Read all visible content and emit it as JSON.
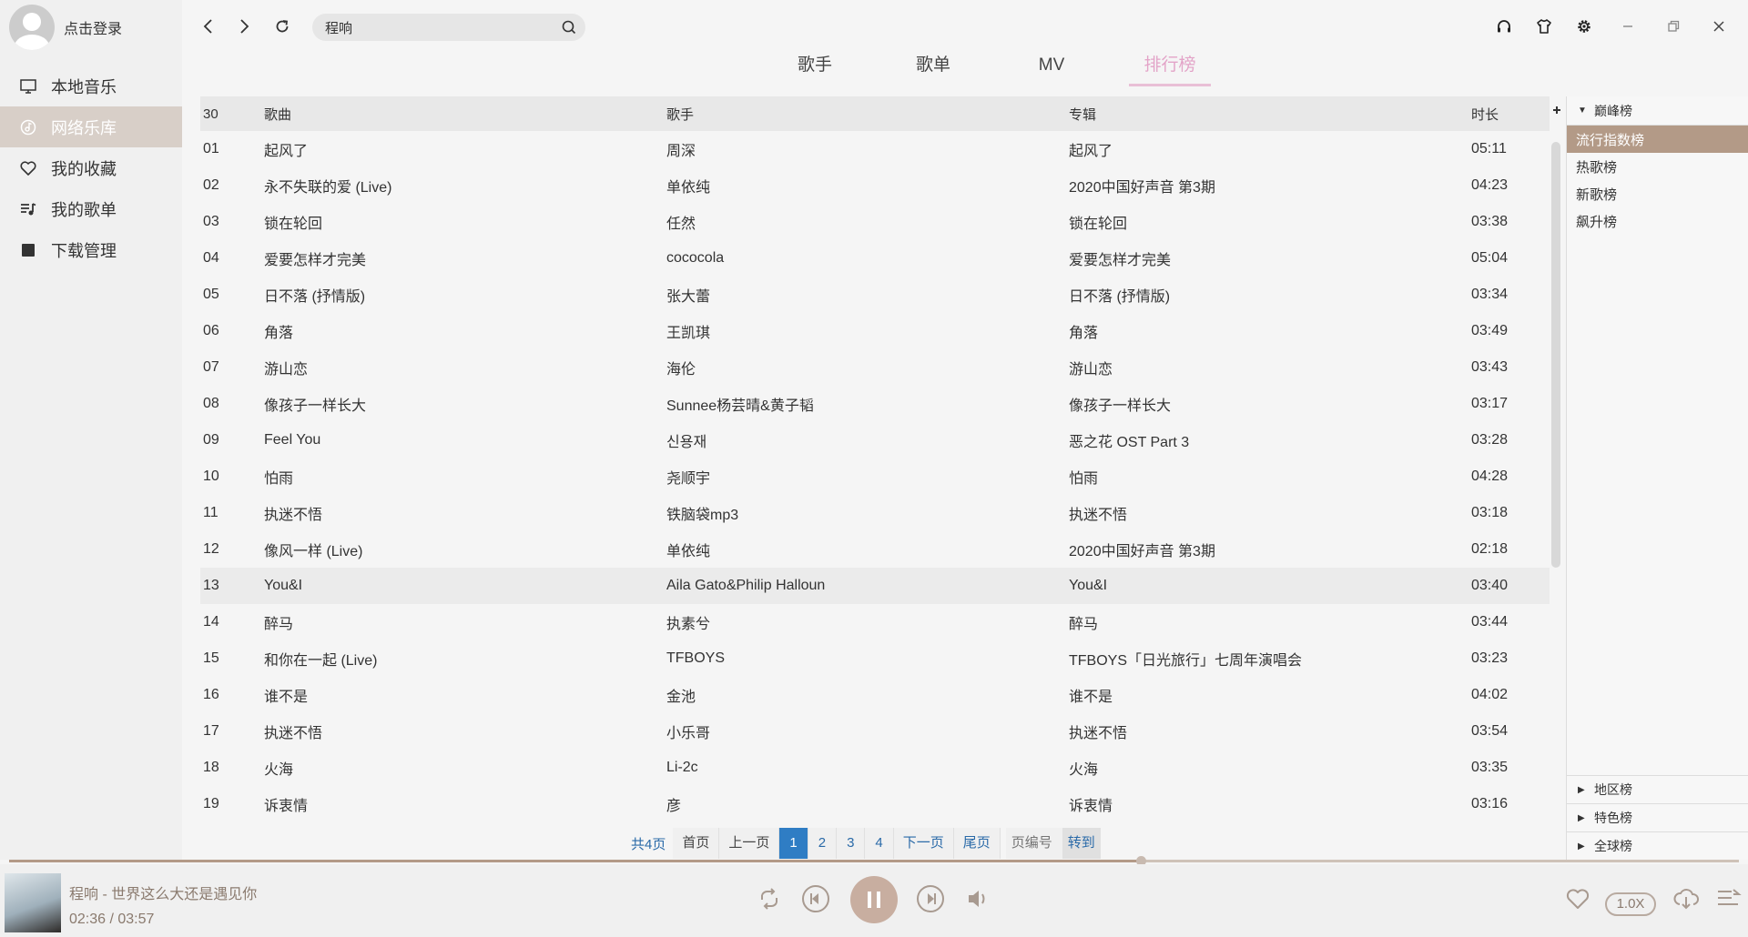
{
  "user": {
    "login_text": "点击登录"
  },
  "sidebar": {
    "items": [
      {
        "label": "本地音乐",
        "icon": "monitor-icon"
      },
      {
        "label": "网络乐库",
        "icon": "music-disc-icon"
      },
      {
        "label": "我的收藏",
        "icon": "heart-icon"
      },
      {
        "label": "我的歌单",
        "icon": "playlist-icon"
      },
      {
        "label": "下载管理",
        "icon": "download-box-icon"
      }
    ],
    "active_index": 1
  },
  "search": {
    "value": "程响"
  },
  "tabs": [
    "歌手",
    "歌单",
    "MV",
    "排行榜"
  ],
  "active_tab": 3,
  "table": {
    "header": {
      "count": "30",
      "song": "歌曲",
      "singer": "歌手",
      "album": "专辑",
      "duration": "时长"
    },
    "rows": [
      {
        "no": "01",
        "song": "起风了",
        "singer": "周深",
        "album": "起风了",
        "duration": "05:11"
      },
      {
        "no": "02",
        "song": "永不失联的爱 (Live)",
        "singer": "单依纯",
        "album": "2020中国好声音 第3期",
        "duration": "04:23"
      },
      {
        "no": "03",
        "song": "锁在轮回",
        "singer": "任然",
        "album": "锁在轮回",
        "duration": "03:38"
      },
      {
        "no": "04",
        "song": "爱要怎样才完美",
        "singer": "cococola",
        "album": "爱要怎样才完美",
        "duration": "05:04"
      },
      {
        "no": "05",
        "song": "日不落 (抒情版)",
        "singer": "张大蕾",
        "album": "日不落 (抒情版)",
        "duration": "03:34"
      },
      {
        "no": "06",
        "song": "角落",
        "singer": "王凯琪",
        "album": "角落",
        "duration": "03:49"
      },
      {
        "no": "07",
        "song": "游山恋",
        "singer": "海伦",
        "album": "游山恋",
        "duration": "03:43"
      },
      {
        "no": "08",
        "song": "像孩子一样长大",
        "singer": "Sunnee杨芸晴&黄子韬",
        "album": "像孩子一样长大",
        "duration": "03:17"
      },
      {
        "no": "09",
        "song": "Feel You",
        "singer": "신용재",
        "album": "恶之花 OST Part 3",
        "duration": "03:28"
      },
      {
        "no": "10",
        "song": "怕雨",
        "singer": "尧顺宇",
        "album": "怕雨",
        "duration": "04:28"
      },
      {
        "no": "11",
        "song": "执迷不悟",
        "singer": "铁脑袋mp3",
        "album": "执迷不悟",
        "duration": "03:18"
      },
      {
        "no": "12",
        "song": "像风一样 (Live)",
        "singer": "单依纯",
        "album": "2020中国好声音 第3期",
        "duration": "02:18"
      },
      {
        "no": "13",
        "song": "You&I",
        "singer": "Aila Gato&Philip Halloun",
        "album": "You&I",
        "duration": "03:40"
      },
      {
        "no": "14",
        "song": "醉马",
        "singer": "执素兮",
        "album": "醉马",
        "duration": "03:44"
      },
      {
        "no": "15",
        "song": "和你在一起 (Live)",
        "singer": "TFBOYS",
        "album": "TFBOYS「日光旅行」七周年演唱会",
        "duration": "03:23"
      },
      {
        "no": "16",
        "song": "谁不是",
        "singer": "金池",
        "album": "谁不是",
        "duration": "04:02"
      },
      {
        "no": "17",
        "song": "执迷不悟",
        "singer": "小乐哥",
        "album": "执迷不悟",
        "duration": "03:54"
      },
      {
        "no": "18",
        "song": "火海",
        "singer": "Li-2c",
        "album": "火海",
        "duration": "03:35"
      },
      {
        "no": "19",
        "song": "诉衷情",
        "singer": "彦",
        "album": "诉衷情",
        "duration": "03:16"
      }
    ],
    "highlight_index": 12
  },
  "rank_panel": {
    "top_group": "巅峰榜",
    "items": [
      "流行指数榜",
      "热歌榜",
      "新歌榜",
      "飙升榜"
    ],
    "active_index": 0,
    "bottom_groups": [
      "地区榜",
      "特色榜",
      "全球榜"
    ]
  },
  "pager": {
    "total": "共4页",
    "first": "首页",
    "prev": "上一页",
    "pages": [
      "1",
      "2",
      "3",
      "4"
    ],
    "current_index": 0,
    "next": "下一页",
    "last": "尾页",
    "page_no_placeholder": "页编号",
    "go": "转到"
  },
  "player": {
    "title": "程响 - 世界这么大还是遇见你",
    "time": "02:36 / 03:57",
    "progress": 0.654,
    "speed": "1.0X"
  },
  "colors": {
    "accent": "#b39a87",
    "tab_active": "#e3a4c8",
    "link_blue": "#2a6aa8",
    "page_active": "#2f7dc4"
  }
}
